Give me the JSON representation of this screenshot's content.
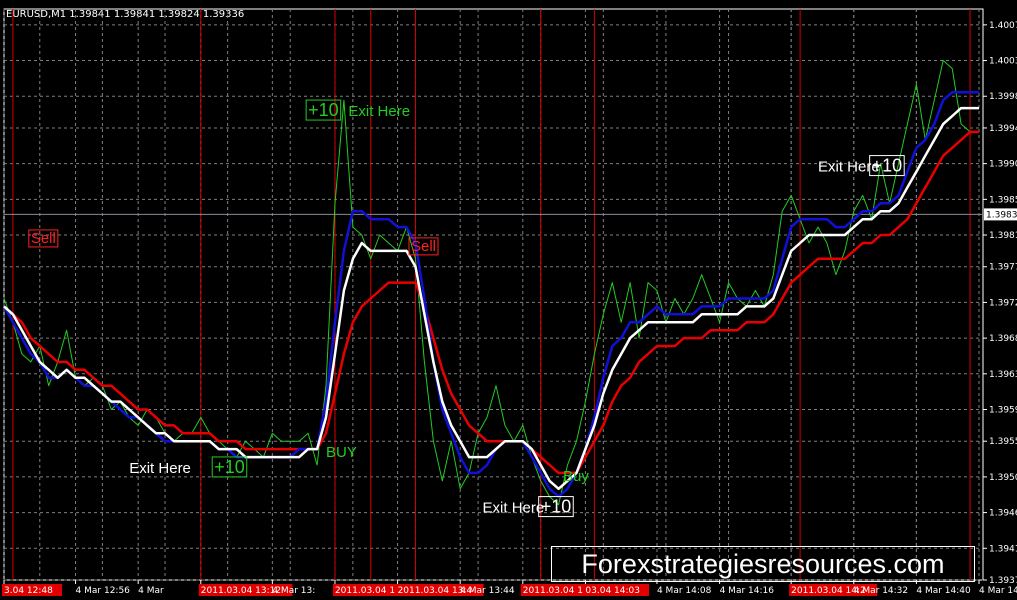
{
  "symbol_info": "EURUSD,M1  1.39841 1.39841 1.39824 1.39336",
  "watermark": "Forexstrategiesresources.com",
  "colors": {
    "background": "#000000",
    "grid": "#7f7f7f",
    "vline": "#d40000",
    "fast_ma": "#1010d8",
    "mid_ma": "#ffffff",
    "slow_ma": "#e80000",
    "price": "#22cc22",
    "label_green": "#22cc22",
    "label_red": "#ff2020",
    "label_white": "#ffffff"
  },
  "chart_data": {
    "type": "line",
    "ylim": [
      1.39375,
      1.40095
    ],
    "y_ticks": [
      "1.40075",
      "1.40030",
      "1.39985",
      "1.39945",
      "1.39900",
      "1.39855",
      "1.39810",
      "1.39770",
      "1.39725",
      "1.39680",
      "1.39635",
      "1.39590",
      "1.39550",
      "1.39505",
      "1.39460",
      "1.39415",
      "1.39375"
    ],
    "current_price": "1.39836",
    "x_ticks": [
      {
        "label": "3.04 12:48",
        "at": 0,
        "highlight": true
      },
      {
        "label": "4 Mar 12:56",
        "at": 8,
        "highlight": false
      },
      {
        "label": "4 Mar",
        "at": 15,
        "highlight": false
      },
      {
        "label": "2011.03.04 13:12",
        "at": 22,
        "highlight": true
      },
      {
        "label": "4 Mar 13:",
        "at": 30,
        "highlight": false
      },
      {
        "label": "2011.03.04 13:30",
        "at": 37,
        "highlight": true
      },
      {
        "label": "2011.03.04 13:4",
        "at": 44,
        "highlight": true
      },
      {
        "label": "4 Mar 13:44",
        "at": 51,
        "highlight": false
      },
      {
        "label": "2011.03.04 13:56",
        "at": 58,
        "highlight": true
      },
      {
        "label": "03.04 14:03",
        "at": 65,
        "highlight": true
      },
      {
        "label": "4 Mar 14:08",
        "at": 73,
        "highlight": false
      },
      {
        "label": "4 Mar 14:16",
        "at": 80,
        "highlight": false
      },
      {
        "label": "2011.03.04 14:2",
        "at": 88,
        "highlight": true
      },
      {
        "label": "4 Mar 14:32",
        "at": 95,
        "highlight": false
      },
      {
        "label": "4 Mar 14:40",
        "at": 102,
        "highlight": false
      },
      {
        "label": "4 Mar 14:48",
        "at": 109,
        "highlight": false
      }
    ],
    "vertical_lines_at": [
      1,
      22,
      37,
      41,
      46,
      60,
      66,
      89,
      108
    ],
    "series": [
      {
        "values": [
          1.3973,
          1.397,
          1.3966,
          1.3965,
          1.3967,
          1.3962,
          1.3965,
          1.3969,
          1.3963,
          1.3962,
          1.3963,
          1.3962,
          1.3959,
          1.396,
          1.3958,
          1.3957,
          1.3959,
          1.3958,
          1.3956,
          1.3955,
          1.3956,
          1.3956,
          1.3958,
          1.3956,
          1.3955,
          1.3954,
          1.3953,
          1.3955,
          1.3954,
          1.3953,
          1.3956,
          1.3955,
          1.3955,
          1.3955,
          1.3956,
          1.3952,
          1.3962,
          1.3985,
          1.3998,
          1.3982,
          1.3981,
          1.3978,
          1.3981,
          1.398,
          1.3979,
          1.3982,
          1.3978,
          1.3965,
          1.3955,
          1.395,
          1.3955,
          1.3949,
          1.3951,
          1.3956,
          1.3958,
          1.3962,
          1.3957,
          1.3955,
          1.3957,
          1.3953,
          1.395,
          1.3948,
          1.3947,
          1.3952,
          1.3955,
          1.396,
          1.3966,
          1.3971,
          1.3975,
          1.397,
          1.3975,
          1.3968,
          1.3975,
          1.3974,
          1.397,
          1.3973,
          1.3971,
          1.3973,
          1.3976,
          1.3973,
          1.397,
          1.3975,
          1.3973,
          1.3972,
          1.3974,
          1.3972,
          1.3976,
          1.3984,
          1.3986,
          1.3983,
          1.398,
          1.3982,
          1.398,
          1.3976,
          1.3979,
          1.3984,
          1.3986,
          1.3983,
          1.399,
          1.3985,
          1.399,
          1.3995,
          1.4,
          1.3993,
          1.3998,
          1.4003,
          1.4002,
          1.3995,
          1.3994,
          1.3994
        ]
      },
      {
        "values": [
          1.3972,
          1.397,
          1.3968,
          1.3966,
          1.3965,
          1.3963,
          1.3963,
          1.3964,
          1.3963,
          1.3962,
          1.3962,
          1.3961,
          1.396,
          1.3959,
          1.3958,
          1.3958,
          1.3957,
          1.3956,
          1.3955,
          1.3955,
          1.3955,
          1.3955,
          1.3955,
          1.3955,
          1.3954,
          1.3954,
          1.3953,
          1.3953,
          1.3953,
          1.3953,
          1.3953,
          1.3953,
          1.3953,
          1.3954,
          1.3954,
          1.3954,
          1.396,
          1.397,
          1.3979,
          1.3984,
          1.3984,
          1.3983,
          1.3983,
          1.3983,
          1.3982,
          1.3982,
          1.398,
          1.3973,
          1.3965,
          1.3959,
          1.3956,
          1.3953,
          1.3951,
          1.3951,
          1.3952,
          1.3954,
          1.3955,
          1.3955,
          1.3955,
          1.3953,
          1.3951,
          1.3949,
          1.3948,
          1.3949,
          1.3951,
          1.3954,
          1.3958,
          1.3963,
          1.3967,
          1.3968,
          1.397,
          1.397,
          1.3971,
          1.3972,
          1.3971,
          1.3971,
          1.3971,
          1.3971,
          1.3972,
          1.3972,
          1.3972,
          1.3973,
          1.3973,
          1.3973,
          1.3973,
          1.3973,
          1.3974,
          1.3978,
          1.3982,
          1.3983,
          1.3983,
          1.3983,
          1.3983,
          1.3982,
          1.3982,
          1.3983,
          1.3984,
          1.3984,
          1.3985,
          1.3985,
          1.3986,
          1.3989,
          1.3992,
          1.3993,
          1.3995,
          1.3998,
          1.3999,
          1.3999,
          1.3999,
          1.3999
        ]
      },
      {
        "values": [
          1.3972,
          1.3971,
          1.3969,
          1.3967,
          1.3965,
          1.3964,
          1.3963,
          1.3964,
          1.3963,
          1.3963,
          1.3962,
          1.3961,
          1.396,
          1.396,
          1.3959,
          1.3958,
          1.3957,
          1.3956,
          1.3956,
          1.3955,
          1.3955,
          1.3955,
          1.3955,
          1.3955,
          1.3954,
          1.3954,
          1.3954,
          1.3953,
          1.3953,
          1.3953,
          1.3953,
          1.3953,
          1.3953,
          1.3953,
          1.3954,
          1.3954,
          1.3958,
          1.3966,
          1.3974,
          1.3978,
          1.398,
          1.3979,
          1.3979,
          1.3979,
          1.3979,
          1.3979,
          1.3977,
          1.3971,
          1.3965,
          1.396,
          1.3957,
          1.3955,
          1.3953,
          1.3953,
          1.3953,
          1.3954,
          1.3955,
          1.3955,
          1.3955,
          1.3954,
          1.3952,
          1.395,
          1.3949,
          1.395,
          1.3951,
          1.3954,
          1.3957,
          1.3961,
          1.3964,
          1.3966,
          1.3968,
          1.3969,
          1.397,
          1.397,
          1.397,
          1.397,
          1.397,
          1.397,
          1.3971,
          1.3971,
          1.3971,
          1.3971,
          1.3971,
          1.3972,
          1.3972,
          1.3972,
          1.3973,
          1.3976,
          1.3979,
          1.398,
          1.3981,
          1.3981,
          1.3981,
          1.3981,
          1.3981,
          1.3982,
          1.3983,
          1.3983,
          1.3984,
          1.3984,
          1.3985,
          1.3987,
          1.3989,
          1.3991,
          1.3993,
          1.3995,
          1.3996,
          1.3997,
          1.3997,
          1.3997
        ]
      },
      {
        "values": [
          1.3972,
          1.3971,
          1.397,
          1.3968,
          1.3967,
          1.3966,
          1.3965,
          1.3965,
          1.3964,
          1.3964,
          1.3963,
          1.3962,
          1.3962,
          1.3961,
          1.396,
          1.3959,
          1.3959,
          1.3958,
          1.3957,
          1.3957,
          1.3956,
          1.3956,
          1.3956,
          1.3956,
          1.3955,
          1.3955,
          1.3955,
          1.3954,
          1.3954,
          1.3954,
          1.3954,
          1.3954,
          1.3954,
          1.3954,
          1.3954,
          1.3954,
          1.3956,
          1.3961,
          1.3966,
          1.397,
          1.3972,
          1.3973,
          1.3974,
          1.3975,
          1.3975,
          1.3975,
          1.3975,
          1.3972,
          1.3968,
          1.3964,
          1.3961,
          1.3959,
          1.3957,
          1.3956,
          1.3955,
          1.3955,
          1.3955,
          1.3955,
          1.3955,
          1.3954,
          1.3953,
          1.3952,
          1.3951,
          1.3951,
          1.3951,
          1.3953,
          1.3955,
          1.3957,
          1.396,
          1.3962,
          1.3963,
          1.3965,
          1.3966,
          1.3967,
          1.3967,
          1.3967,
          1.3968,
          1.3968,
          1.3968,
          1.3969,
          1.3969,
          1.3969,
          1.3969,
          1.397,
          1.397,
          1.397,
          1.3971,
          1.3973,
          1.3975,
          1.3976,
          1.3977,
          1.3978,
          1.3978,
          1.3978,
          1.3978,
          1.3979,
          1.398,
          1.398,
          1.3981,
          1.3981,
          1.3982,
          1.3983,
          1.3985,
          1.3987,
          1.3989,
          1.3991,
          1.3992,
          1.3993,
          1.3994,
          1.3994
        ]
      }
    ],
    "annotations": [
      {
        "text": "Sell",
        "color": "red",
        "boxed": true,
        "at": [
          3,
          1.398
        ]
      },
      {
        "text": "+10",
        "color": "green",
        "boxed": true,
        "at": [
          34,
          1.3996
        ]
      },
      {
        "text": "Exit Here",
        "color": "green",
        "boxed": false,
        "at": [
          38.5,
          1.3996
        ]
      },
      {
        "text": "Sell",
        "color": "red",
        "boxed": true,
        "at": [
          45.5,
          1.3979
        ]
      },
      {
        "text": "Exit Here",
        "color": "white",
        "boxed": false,
        "at": [
          14,
          1.3951
        ]
      },
      {
        "text": "+10",
        "color": "green",
        "boxed": true,
        "at": [
          23.5,
          1.3951
        ]
      },
      {
        "text": "BUY",
        "color": "green",
        "boxed": false,
        "at": [
          36,
          1.3953
        ]
      },
      {
        "text": "Exit Here",
        "color": "white",
        "boxed": false,
        "at": [
          53.5,
          1.3946
        ]
      },
      {
        "text": "+10",
        "color": "white",
        "boxed": true,
        "at": [
          60,
          1.3946
        ]
      },
      {
        "text": "Buy",
        "color": "green",
        "boxed": false,
        "at": [
          62.5,
          1.395
        ]
      },
      {
        "text": "Exit Here",
        "color": "white",
        "boxed": false,
        "at": [
          91,
          1.3989
        ]
      },
      {
        "text": "+10",
        "color": "white",
        "boxed": true,
        "at": [
          97,
          1.3989
        ]
      }
    ]
  }
}
